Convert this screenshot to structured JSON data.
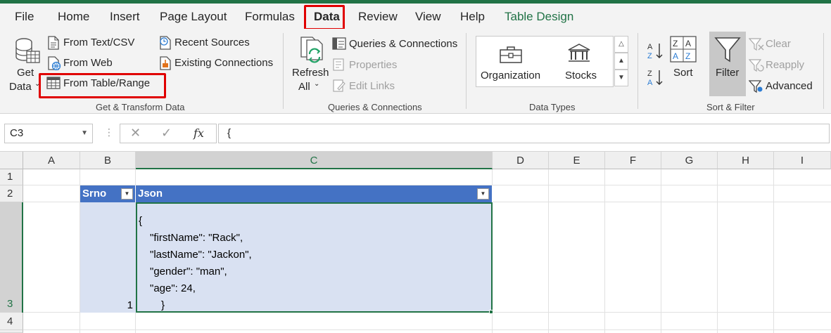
{
  "menu": {
    "tabs": [
      "File",
      "Home",
      "Insert",
      "Page Layout",
      "Formulas",
      "Data",
      "Review",
      "View",
      "Help",
      "Table Design"
    ],
    "active_tab": "Data"
  },
  "ribbon": {
    "get_transform": {
      "get_data_line1": "Get",
      "get_data_line2": "Data",
      "from_text_csv": "From Text/CSV",
      "from_web": "From Web",
      "from_table_range": "From Table/Range",
      "recent_sources": "Recent Sources",
      "existing_connections": "Existing Connections",
      "label": "Get & Transform Data"
    },
    "queries": {
      "refresh_line1": "Refresh",
      "refresh_line2": "All",
      "queries_connections": "Queries & Connections",
      "properties": "Properties",
      "edit_links": "Edit Links",
      "label": "Queries & Connections"
    },
    "data_types": {
      "organization": "Organization",
      "stocks": "Stocks",
      "label": "Data Types"
    },
    "sort_filter": {
      "sort": "Sort",
      "filter": "Filter",
      "clear": "Clear",
      "reapply": "Reapply",
      "advanced": "Advanced",
      "label": "Sort & Filter"
    }
  },
  "formula_bar": {
    "name_box": "C3",
    "fx": "fx",
    "formula": "{"
  },
  "grid": {
    "columns": [
      "A",
      "B",
      "C",
      "D",
      "E",
      "F",
      "G",
      "H",
      "I"
    ],
    "selected_column": "C",
    "rows": [
      "1",
      "2",
      "3",
      "4"
    ],
    "selected_row": "3",
    "table": {
      "headers": [
        "Srno",
        "Json"
      ],
      "srno": "1",
      "json_lines": [
        "{",
        "\"firstName\": \"Rack\",",
        "\"lastName\": \"Jackon\",",
        "\"gender\": \"man\",",
        "\"age\": 24,",
        "}"
      ]
    }
  },
  "colors": {
    "excel_green": "#217346",
    "table_header": "#4472c4",
    "table_band": "#d9e1f2",
    "highlight_red": "#e00000"
  }
}
